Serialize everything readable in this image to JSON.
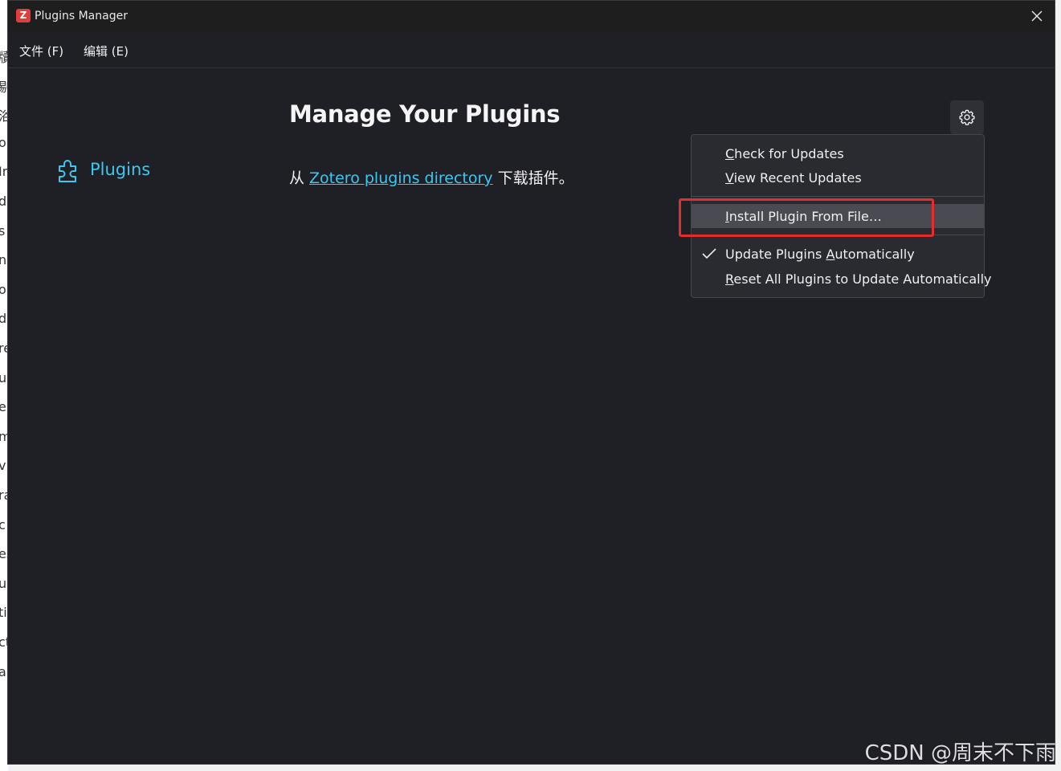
{
  "window": {
    "title": "Plugins Manager",
    "app_icon_letter": "Z",
    "close_icon": "close-icon"
  },
  "background_strip": {
    "chars": [
      "牘",
      "剔",
      "浴",
      "o",
      "Ir",
      "d",
      "s",
      "n",
      "o",
      "d",
      "re",
      "ur",
      "er",
      "m",
      "v",
      "ra",
      "c",
      "es",
      "uc",
      "ti",
      "ct",
      "a"
    ]
  },
  "menubar": {
    "file": "文件 (F)",
    "edit": "编辑 (E)"
  },
  "sidebar": {
    "plugins_label": "Plugins",
    "plugins_icon": "puzzle-piece-icon"
  },
  "main": {
    "title": "Manage Your Plugins",
    "intro_prefix": "从",
    "intro_link": "Zotero plugins directory",
    "intro_suffix": "下载插件。"
  },
  "gear": {
    "icon": "gear-icon"
  },
  "dropdown": {
    "check_updates_u": "C",
    "check_updates_rest": "heck for Updates",
    "view_recent_u": "V",
    "view_recent_rest": "iew Recent Updates",
    "install_u": "I",
    "install_rest": "nstall Plugin From File…",
    "auto_update_pre": "Update Plugins ",
    "auto_update_u": "A",
    "auto_update_rest": "utomatically",
    "auto_update_checked": true,
    "reset_u": "R",
    "reset_rest": "eset All Plugins to Update Automatically"
  },
  "annotation": {
    "highlight_color": "#e52d2d"
  },
  "colors": {
    "accent": "#3cc8f0",
    "window_bg": "#1f1f26",
    "menu_bg": "#2a2a31",
    "hover_bg": "#4a4a52"
  },
  "watermark": "CSDN @周末不下雨"
}
